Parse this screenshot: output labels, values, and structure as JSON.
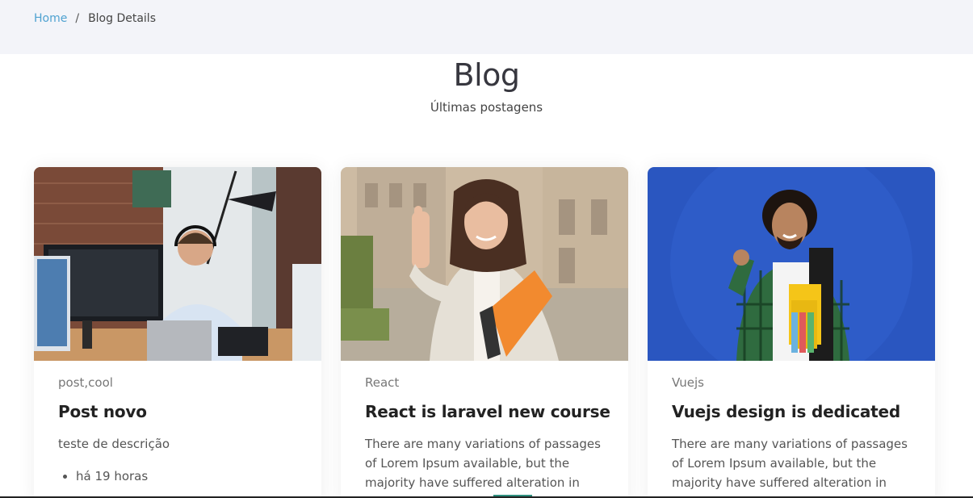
{
  "breadcrumb": {
    "home": "Home",
    "separator": "/",
    "current": "Blog Details"
  },
  "section": {
    "title": "Blog",
    "subtitle": "Últimas postagens"
  },
  "posts": [
    {
      "image": "photo of man with headset working at desktop computer",
      "tags": "post,cool",
      "title": "Post novo",
      "description": "teste de descrição",
      "meta": [
        "há 19 horas"
      ]
    },
    {
      "image": "photo of smiling woman giving thumbs up holding orange folder",
      "tags": "React",
      "title": "React is laravel new course",
      "description": "There are many variations of passages of Lorem Ipsum available, but the majority have suffered alteration in"
    },
    {
      "image": "photo of curly-haired student with yellow notebooks on blue background",
      "tags": "Vuejs",
      "title": "Vuejs design is dedicated",
      "description": "There are many variations of passages of Lorem Ipsum available, but the majority have suffered alteration in"
    }
  ],
  "colors": {
    "link": "#4fa2d1",
    "topbar_bg": "#f3f4f9",
    "title_text": "#37373f"
  }
}
